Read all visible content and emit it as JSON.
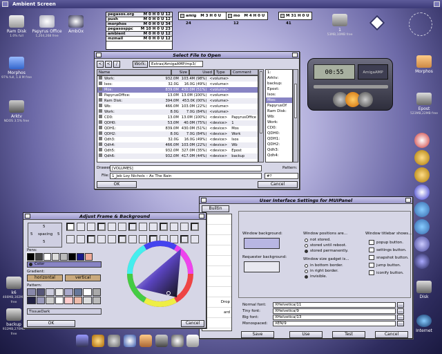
{
  "screen": {
    "title": "Ambient Screen"
  },
  "dock_list": [
    {
      "name": "pegasos.org",
      "value": "M 0 H 0 U 12"
    },
    {
      "name": "push",
      "value": "M 0 H 0 U 12"
    },
    {
      "name": "morphos",
      "value": "M 0 H 0 U 34"
    },
    {
      "name": "pegasosppc",
      "value": "M 10 H 0 U 23"
    },
    {
      "name": "ambient",
      "value": "M 0 H 0 U 12"
    },
    {
      "name": "mzmail",
      "value": "M 0 H 0 U 12"
    }
  ],
  "mini_windows": [
    {
      "label": "amig",
      "value": "M 3 H 0 U 24"
    },
    {
      "label": "mo",
      "value": "M 4 H 0 U 12"
    },
    {
      "label": "",
      "value": "M 31 H 0 U 41"
    }
  ],
  "desktop_icons": [
    {
      "label": "Ram Disk",
      "sub": "1.0% full"
    },
    {
      "label": "Papyrus Office",
      "sub": "1,204,268 free"
    },
    {
      "label": "AmbOx",
      "sub": ""
    },
    {
      "label": "Morphos",
      "sub": "97% full, 1.8 M free"
    },
    {
      "label": "Arktv",
      "sub": "NDOS 3.5% free"
    },
    {
      "label": "1",
      "sub": "53MB,10MB free"
    },
    {
      "label": "Morphos",
      "sub": ""
    },
    {
      "label": "Epost",
      "sub": "523MB,22MB free"
    },
    {
      "label": "k6",
      "sub": "466MB,302MB free"
    },
    {
      "label": "backup",
      "sub": "932MB,270MB free"
    },
    {
      "label": "Disk",
      "sub": ""
    },
    {
      "label": "Internet",
      "sub": ""
    }
  ],
  "file_requester": {
    "title": "Select File to Open",
    "nav": [
      "<",
      "<",
      "/",
      "Work:",
      "Extras/AmigaAMP/mp3/"
    ],
    "columns": [
      "Name",
      "Size",
      "Used",
      "Type",
      "Comment"
    ],
    "rows": [
      {
        "name": "Work:",
        "size": "932.0M",
        "used": "103.4M (98%)",
        "type": "<volume>",
        "comment": ""
      },
      {
        "name": "Isos:",
        "size": "32.0G",
        "used": "16.0G (49%)",
        "type": "<volume>",
        "comment": ""
      },
      {
        "name": "Mos:",
        "size": "839.0M",
        "used": "430.0M (51%)",
        "type": "<volume>",
        "comment": ""
      },
      {
        "name": "PapyrusOffice:",
        "size": "13.0M",
        "used": "13.0M (100%)",
        "type": "<volume>",
        "comment": ""
      },
      {
        "name": "Ram Disk:",
        "size": "394.0M",
        "used": "453.0K (00%)",
        "type": "<volume>",
        "comment": ""
      },
      {
        "name": "Wb:",
        "size": "466.0M",
        "used": "103.0M (22%)",
        "type": "<volume>",
        "comment": ""
      },
      {
        "name": "Work:",
        "size": "8.0G",
        "used": "7.0G (84%)",
        "type": "<volume>",
        "comment": ""
      },
      {
        "name": "CD0:",
        "size": "13.0M",
        "used": "13.0M (100%)",
        "type": "<device>",
        "comment": "PapyrusOffice"
      },
      {
        "name": "QDH0:",
        "size": "53.0M",
        "used": "40.0M (75%)",
        "type": "<device>",
        "comment": "1"
      },
      {
        "name": "QDH1:",
        "size": "839.0M",
        "used": "430.0M (51%)",
        "type": "<device>",
        "comment": "Mos"
      },
      {
        "name": "QDH2:",
        "size": "8.0G",
        "used": "7.0G (84%)",
        "type": "<device>",
        "comment": "Work"
      },
      {
        "name": "Qdh3:",
        "size": "32.0G",
        "used": "16.0G (49%)",
        "type": "<device>",
        "comment": "Isos"
      },
      {
        "name": "Qdh4:",
        "size": "466.0M",
        "used": "103.0M (22%)",
        "type": "<device>",
        "comment": "Wb"
      },
      {
        "name": "Qdh5:",
        "size": "932.0M",
        "used": "327.0M (35%)",
        "type": "<device>",
        "comment": "Epost"
      },
      {
        "name": "Qdh6:",
        "size": "932.0M",
        "used": "417.0M (44%)",
        "type": "<device>",
        "comment": "backup"
      }
    ],
    "side_list": [
      "1:",
      "Arktv:",
      "backup:",
      "Epost:",
      "Isos:",
      "Mos:",
      "PapyrusOf",
      "Ram Disk:",
      "Wb:",
      "Work:",
      "CD0:",
      "QDH0:",
      "QDH1:",
      "QDH2:",
      "Qdh3:",
      "Qdh4:"
    ],
    "drawer_label": "Drawer:",
    "drawer_value": "[VOLUMES]",
    "file_label": "File:",
    "file_value": "1_Jeb Loy Nichols – As The Rain",
    "pattern_label": "Pattern:",
    "pattern_value": "#?",
    "ok": "OK",
    "cancel": "Cancel"
  },
  "frame_window": {
    "title": "Adjust Frame & Background",
    "spacing_label": "spacing",
    "spacing_top": "5",
    "spacing_left": "5",
    "spacing_right": "5",
    "spacing_bottom": "5",
    "pens_label": "Pens:",
    "color_label": "Color",
    "gradient_label": "Gradient:",
    "horizontal": "horizontal",
    "vertical": "vertical",
    "pattern_label": "Pattern:",
    "pattern_name": "TissueDark",
    "ok": "OK",
    "cancel": "Cancel",
    "pen_colors": [
      "#000000",
      "#444444",
      "#ffffff",
      "#dddddd",
      "#bbbbbb",
      "#000000",
      "#1a1a88",
      "#eeaa99"
    ],
    "pattern_colors": [
      "#8888aa",
      "#555577",
      "#ccccdd",
      "#eeeeee",
      "#aaaacc",
      "#667799",
      "#ffffff",
      "#aaaaaa",
      "#222244",
      "#9999bb",
      "#cccccc",
      "#ffffff",
      "#ffcccc",
      "#eebbaa",
      "#dddddd",
      "#bbbbbb"
    ]
  },
  "mui_window": {
    "title": "User Interface Settings for MUIPanel",
    "class_label": "Builtin",
    "partial_list": [
      "",
      "",
      "",
      "",
      "",
      "",
      "",
      "",
      "Drop",
      "ard",
      ""
    ],
    "window_bg": "Window background:",
    "requester_bg": "Requester background:",
    "positions_title": "Window positions are...",
    "positions": [
      {
        "label": "not stored.",
        "on": false
      },
      {
        "label": "stored until reboot.",
        "on": false
      },
      {
        "label": "stored permanently.",
        "on": true
      }
    ],
    "size_title": "Window size gadget is...",
    "size": [
      {
        "label": "in bottom border.",
        "on": false
      },
      {
        "label": "in right border.",
        "on": false
      },
      {
        "label": "invisible.",
        "on": true
      }
    ],
    "titlebar_title": "Window titlebar shows...",
    "titlebar": [
      {
        "label": "popup button."
      },
      {
        "label": "settings button."
      },
      {
        "label": "snapshot button."
      },
      {
        "label": "jump button."
      },
      {
        "label": "iconify button."
      }
    ],
    "fonts": [
      {
        "label": "Normal font:",
        "value": "XHelvetica/11"
      },
      {
        "label": "Tiny font:",
        "value": "XHelvetica/9"
      },
      {
        "label": "Big font:",
        "value": "XHelvetica/13"
      },
      {
        "label": "Monospaced:",
        "value": "XEN/9"
      }
    ],
    "save": "Save",
    "use": "Use",
    "test": "Test",
    "cancel": "Cancel"
  },
  "player": {
    "time": "00:55",
    "label": "AmigaAMP"
  },
  "colors": {
    "accent": "#8884c4",
    "titlebar": "#9d9acd",
    "desk": "#6d6aa8"
  }
}
